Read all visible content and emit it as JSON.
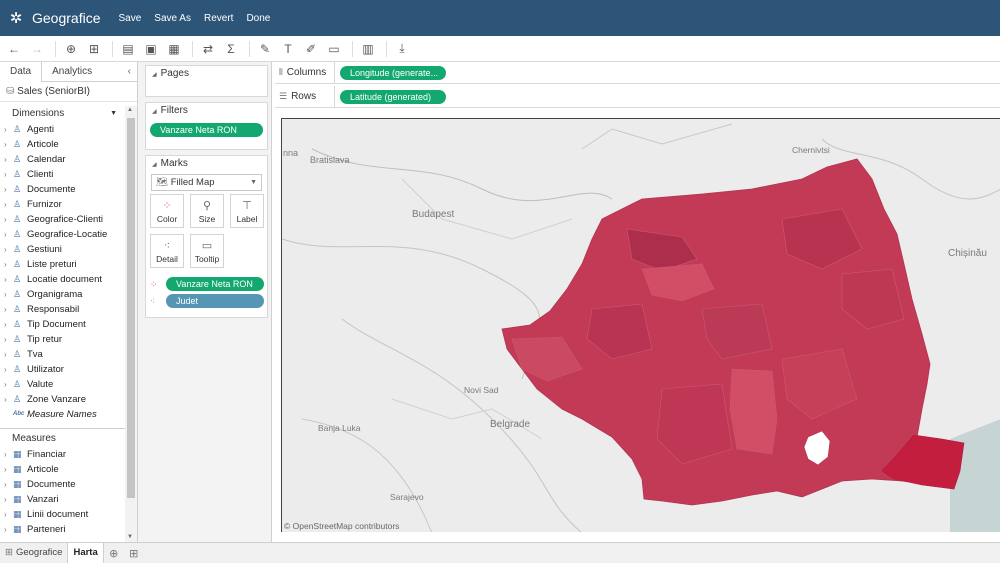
{
  "titlebar": {
    "app_title": "Geografice",
    "menu": [
      "Save",
      "Save As",
      "Revert",
      "Done"
    ]
  },
  "left_pane": {
    "tabs": [
      "Data",
      "Analytics"
    ],
    "datasource": "Sales (SeniorBI)",
    "dimensions_header": "Dimensions",
    "dimensions": [
      "Agenti",
      "Articole",
      "Calendar",
      "Clienti",
      "Documente",
      "Furnizor",
      "Geografice-Clienti",
      "Geografice-Locatie",
      "Gestiuni",
      "Liste preturi",
      "Locatie document",
      "Organigrama",
      "Responsabil",
      "Tip Document",
      "Tip retur",
      "Tva",
      "Utilizator",
      "Valute",
      "Zone Vanzare"
    ],
    "measure_names": "Measure Names",
    "measures_header": "Measures",
    "measures": [
      "Financiar",
      "Articole",
      "Documente",
      "Vanzari",
      "Linii document",
      "Parteneri"
    ]
  },
  "cards": {
    "pages_title": "Pages",
    "filters_title": "Filters",
    "filter_pill": "Vanzare Neta RON",
    "marks_title": "Marks",
    "mark_type": "Filled Map",
    "buttons": [
      "Color",
      "Size",
      "Label",
      "Detail",
      "Tooltip"
    ],
    "color_pill": "Vanzare Neta RON",
    "detail_pill": "Judet"
  },
  "shelves": {
    "columns_label": "Columns",
    "columns_pill": "Longitude (generate...",
    "rows_label": "Rows",
    "rows_pill": "Latitude (generated)"
  },
  "map": {
    "labels": [
      "Bratislava",
      "Budapest",
      "Chernivtsi",
      "Chișinău",
      "Novi Sad",
      "Belgrade",
      "Banja Luka",
      "Sarajevo"
    ],
    "attribution": "© OpenStreetMap contributors",
    "colors": {
      "base": "#c23a55",
      "dark": "#ad2d4c",
      "light": "#d24e66",
      "highlight": "#c41e3e"
    }
  },
  "bottom_bar": {
    "sheets": [
      "Geografice",
      "Harta"
    ]
  }
}
